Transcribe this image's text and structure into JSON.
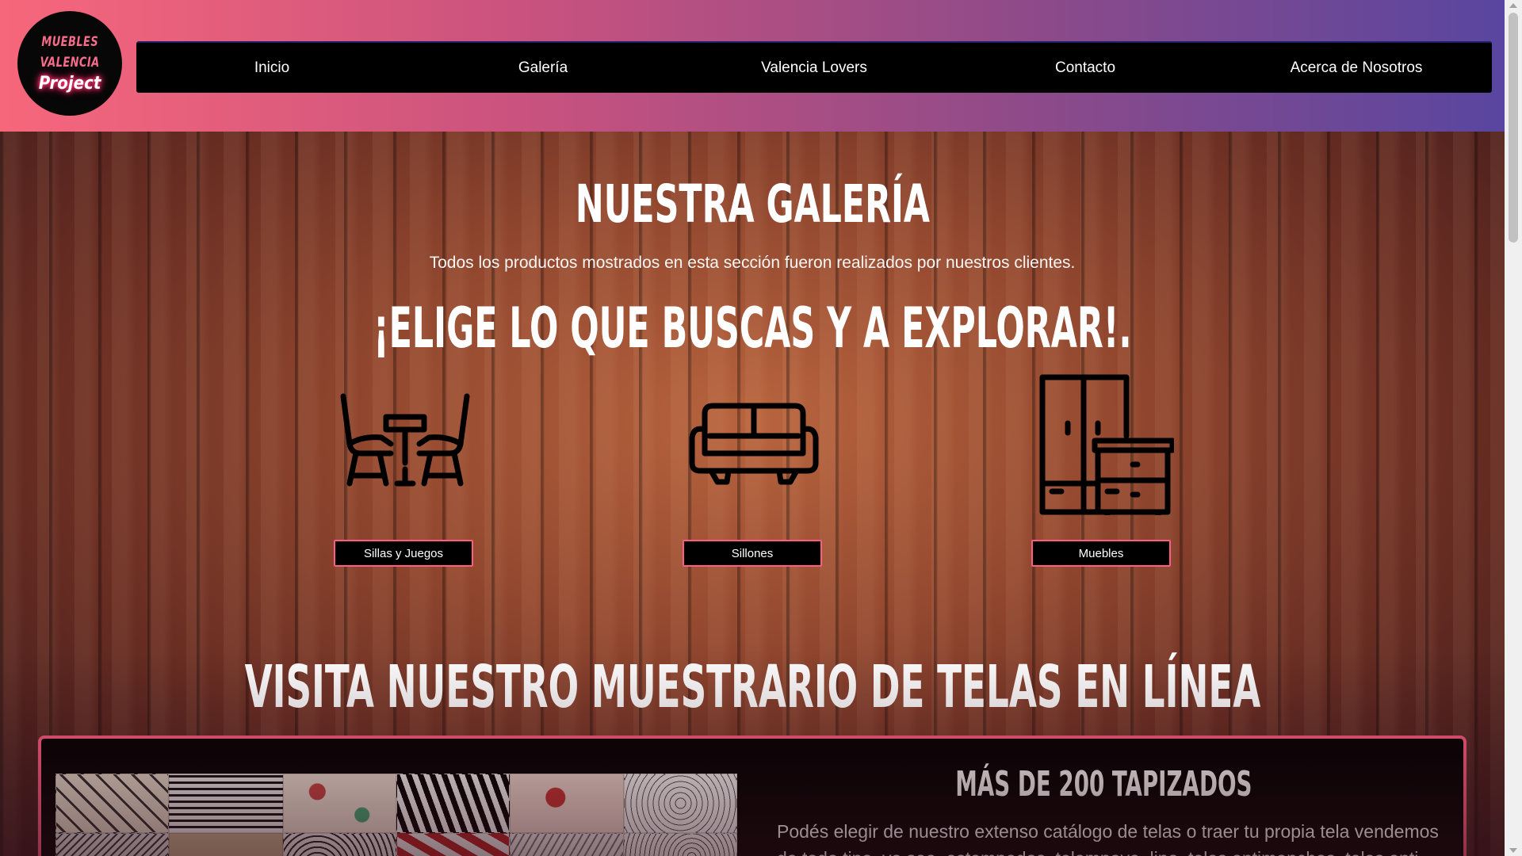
{
  "logo": {
    "line1": "MUEBLES",
    "line2": "VALENCIA",
    "line3": "Project"
  },
  "nav": {
    "items": [
      {
        "label": "Inicio"
      },
      {
        "label": "Galería"
      },
      {
        "label": "Valencia Lovers"
      },
      {
        "label": "Contacto"
      },
      {
        "label": "Acerca de Nosotros"
      }
    ]
  },
  "hero": {
    "title": "Nuestra Galería",
    "subtitle": "Todos los productos mostrados en esta sección fueron realizados por nuestros clientes.",
    "explore": "¡Elige lo que buscas y a explorar!."
  },
  "categories": [
    {
      "label": "Sillas y Juegos",
      "icon": "dining-set-icon"
    },
    {
      "label": "Sillones",
      "icon": "sofa-icon"
    },
    {
      "label": "Muebles",
      "icon": "wardrobe-icon"
    }
  ],
  "telas": {
    "title": "Visita nuestro muestrario de telas en línea",
    "box_title": "Más de 200 tapizados",
    "box_text": "Podés elegir de nuestro extenso catálogo de telas o traer tu propia tela vendemos de todo tipo, ya sea, estampados, telampaya, lino, telas antimanchas, telas anti"
  },
  "colors": {
    "accent": "#ff5d82",
    "header_start": "#f7677b",
    "header_end": "#5946a0",
    "nav_bg": "#000000"
  }
}
